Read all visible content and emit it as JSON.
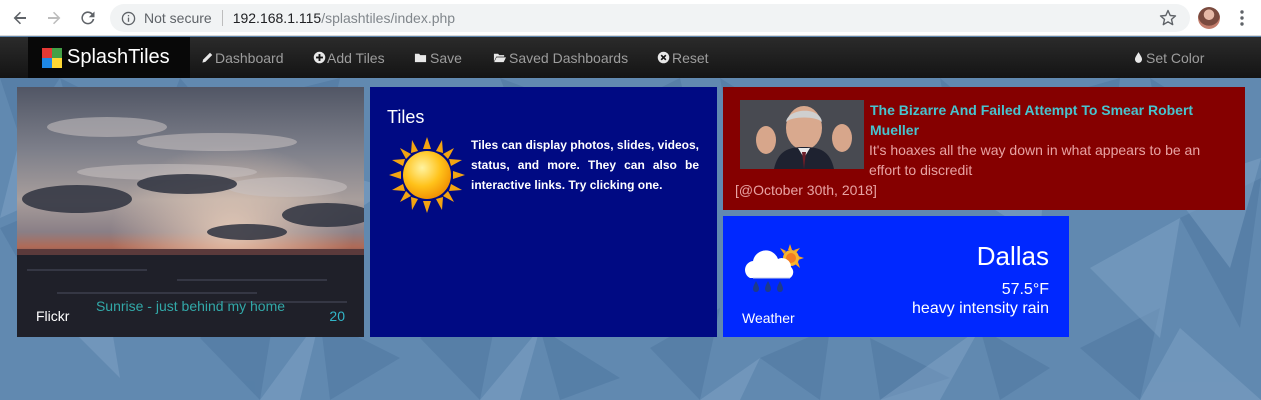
{
  "browser": {
    "security_label": "Not secure",
    "url_host": "192.168.1.115",
    "url_path": "/splashtiles/index.php"
  },
  "navbar": {
    "brand": "SplashTiles",
    "brand_colors": [
      "#e53935",
      "#43a047",
      "#1e88e5",
      "#fdd835"
    ],
    "items": [
      {
        "label": "Dashboard",
        "icon": "pencil-icon"
      },
      {
        "label": "Add Tiles",
        "icon": "plus-circle-icon"
      },
      {
        "label": "Save",
        "icon": "folder-icon"
      },
      {
        "label": "Saved Dashboards",
        "icon": "folder-open-icon"
      },
      {
        "label": "Reset",
        "icon": "x-circle-icon"
      },
      {
        "label": "Set Color",
        "icon": "droplet-icon"
      }
    ]
  },
  "tiles": {
    "photo": {
      "title": "Sunrise - just behind my home",
      "source": "Flickr",
      "count": "20"
    },
    "info": {
      "title": "Tiles",
      "body": "Tiles can display photos, slides, videos, status, and more. They can also be interactive links. Try clicking one.",
      "color": "#000a83"
    },
    "news": {
      "headline": "The Bizarre And Failed Attempt To Smear Robert Mueller",
      "body": "It's hoaxes all the way down in what appears to be an effort to discredit",
      "date": "[@October 30th, 2018]",
      "color": "#850000"
    },
    "weather": {
      "city": "Dallas",
      "temperature": "57.5°F",
      "condition": "heavy intensity rain",
      "label": "Weather",
      "icon": "rain-sun-cloud-icon",
      "color": "#0028ff"
    }
  }
}
